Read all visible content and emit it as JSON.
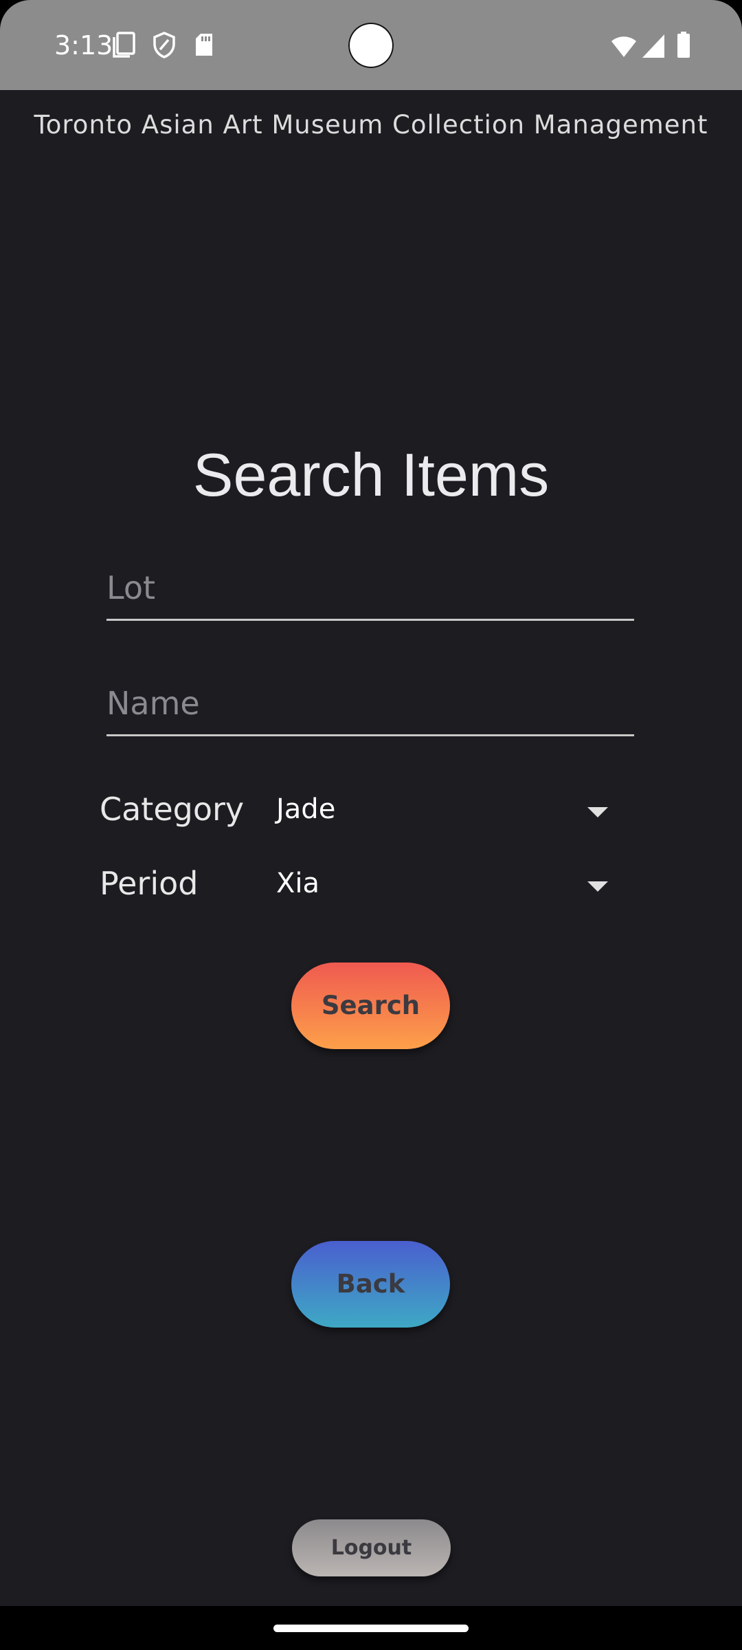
{
  "status_bar": {
    "time": "3:13",
    "left_icons": [
      "screen-icon",
      "shield-icon",
      "sd-card-icon"
    ],
    "right_icons": [
      "wifi-icon",
      "signal-icon",
      "battery-icon"
    ]
  },
  "app": {
    "title": "Toronto Asian Art Museum Collection Management"
  },
  "page": {
    "title": "Search Items"
  },
  "form": {
    "lot_placeholder": "Lot",
    "lot_value": "",
    "name_placeholder": "Name",
    "name_value": "",
    "category_label": "Category",
    "category_value": "Jade",
    "period_label": "Period",
    "period_value": "Xia"
  },
  "buttons": {
    "search_label": "Search",
    "back_label": "Back",
    "logout_label": "Logout"
  },
  "colors": {
    "background": "#1d1c21",
    "status_bar": "#8c8c8c",
    "search_gradient": [
      "#ef5a50",
      "#fda04a"
    ],
    "back_gradient": [
      "#4a5fcf",
      "#3ea9c4"
    ],
    "logout_gradient": [
      "#8c8a8c",
      "#bbb5b3"
    ]
  }
}
